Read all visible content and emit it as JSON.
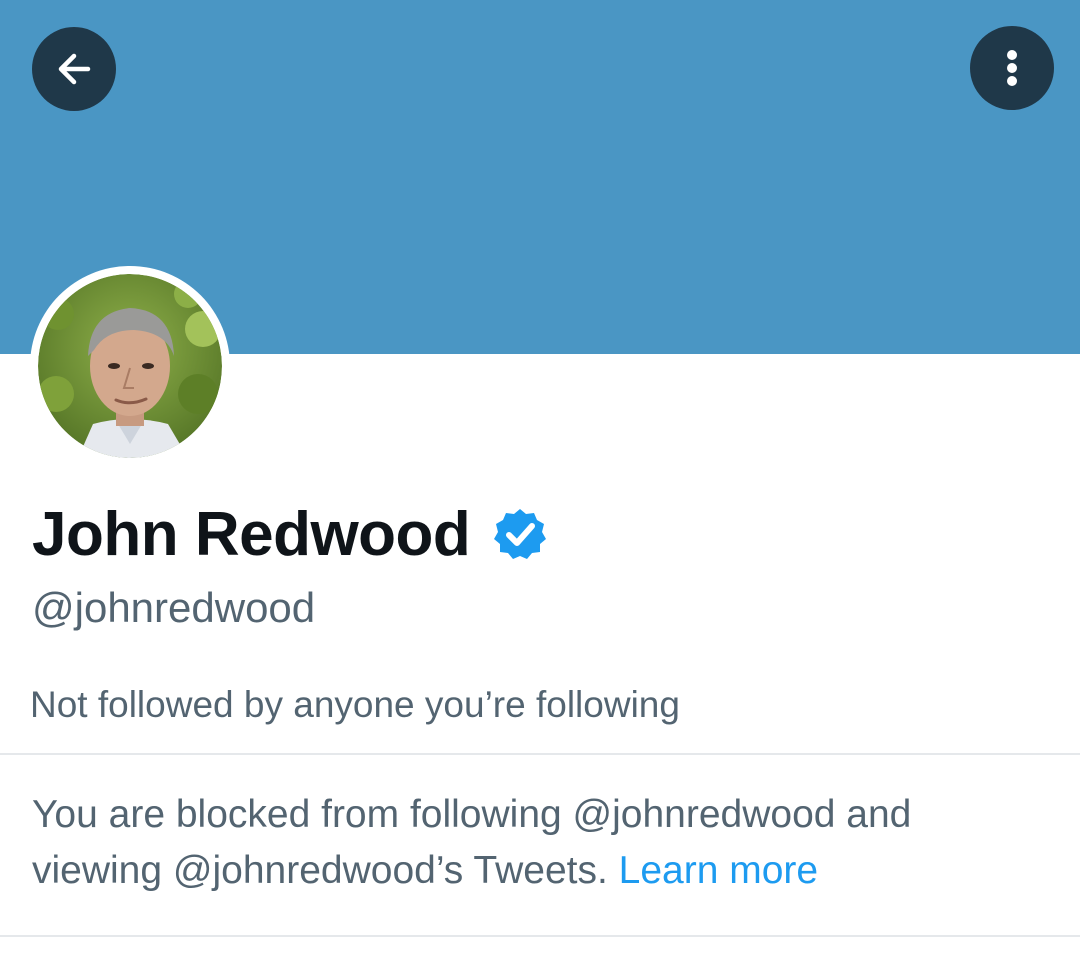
{
  "colors": {
    "banner": "#4a96c4",
    "verified_badge": "#1d9bf0",
    "link": "#1d9bf0",
    "primary_text": "#0f1419",
    "secondary_text": "#536471"
  },
  "header": {
    "back_icon": "arrow-left-icon",
    "more_icon": "more-vertical-icon"
  },
  "profile": {
    "display_name": "John Redwood",
    "verified_icon": "verified-badge-icon",
    "handle": "@johnredwood",
    "followed_by": "Not followed by anyone you’re following"
  },
  "blocked_notice": {
    "text": "You are blocked from following @johnredwood and viewing @johnredwood’s Tweets. ",
    "link_label": "Learn more"
  }
}
